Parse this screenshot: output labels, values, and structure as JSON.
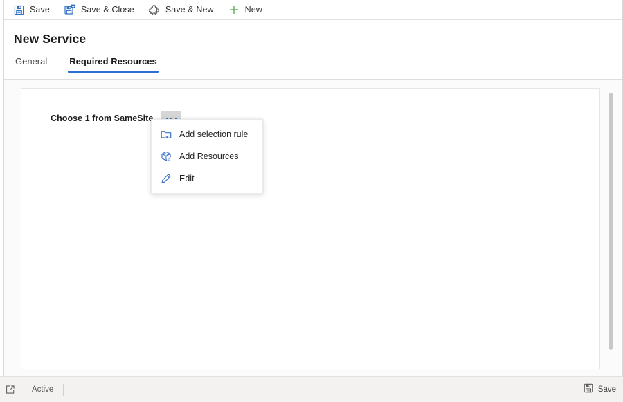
{
  "toolbar": {
    "buttons": [
      {
        "label": "Save",
        "icon": "save-icon"
      },
      {
        "label": "Save & Close",
        "icon": "save-close-icon"
      },
      {
        "label": "Save & New",
        "icon": "save-new-icon"
      },
      {
        "label": "New",
        "icon": "plus-icon"
      }
    ]
  },
  "header": {
    "title": "New Service",
    "tabs": [
      {
        "label": "General",
        "active": false
      },
      {
        "label": "Required Resources",
        "active": true
      }
    ]
  },
  "content": {
    "choose_label": "Choose 1 from SameSite",
    "ellipsis_button": "...",
    "menu": {
      "items": [
        {
          "label": "Add selection rule",
          "icon": "folder-add-icon"
        },
        {
          "label": "Add Resources",
          "icon": "package-icon"
        },
        {
          "label": "Edit",
          "icon": "pencil-icon"
        }
      ]
    }
  },
  "statusbar": {
    "expand_icon": "popout-icon",
    "state": "Active",
    "save_label": "Save",
    "save_icon": "save-icon"
  },
  "colors": {
    "accent_blue": "#2b6fd1",
    "icon_blue": "#3b73c4",
    "plus_green": "#4ca64c",
    "text_primary": "#201f1e",
    "text_secondary": "#484644",
    "statusbar_bg": "#f3f2f1"
  }
}
